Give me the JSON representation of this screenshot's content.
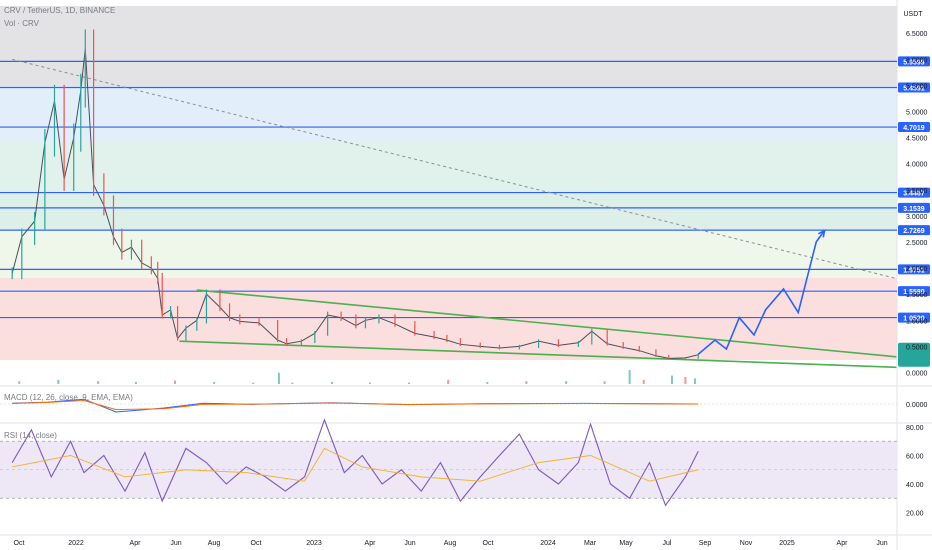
{
  "header": {
    "symbol_line": "CRV / TetherUS, 1D, BINANCE",
    "volume_line": "Vol · CRV",
    "currency": "USDT"
  },
  "colors": {
    "up": "#26a69a",
    "down": "#ef5350",
    "level_line": "#2962ff",
    "trend_line": "#4caf50",
    "projection": "#2962ff",
    "rsi_band": "#e9e3f7",
    "rsi_line": "#7e57c2",
    "rsi_ma": "#f0b429",
    "macd_line": "#2962ff",
    "macd_signal": "#ff6d00",
    "last_price_tag": "#26a69a"
  },
  "chart_data": [
    {
      "type": "line",
      "title": "CRV / TetherUS, 1D, BINANCE",
      "price_axis_ticks": [
        "6.5000",
        "6.0000",
        "5.5000",
        "5.0000",
        "4.5000",
        "4.0000",
        "3.5000",
        "3.0000",
        "2.5000",
        "2.0000",
        "1.5000",
        "1.0000",
        "0.5000",
        "0.0000"
      ],
      "time_axis_ticks": [
        "Oct",
        "2022",
        "Apr",
        "Jun",
        "Aug",
        "Oct",
        "2023",
        "Apr",
        "Jun",
        "Aug",
        "Oct",
        "2024",
        "Mar",
        "May",
        "Jul",
        "Sep",
        "Nov",
        "2025",
        "Apr",
        "Jun"
      ],
      "horizontal_levels": [
        "5.9599",
        "5.4591",
        "4.7019",
        "3.4467",
        "3.1539",
        "2.7269",
        "1.9751",
        "1.5580",
        "1.0520"
      ],
      "price_series": {
        "name": "",
        "dates": [
          "2021-09-20",
          "2021-10-05",
          "2021-10-25",
          "2021-11-10",
          "2021-11-25",
          "2021-12-10",
          "2021-12-25",
          "2022-01-05",
          "2022-01-12",
          "2022-01-25",
          "2022-02-10",
          "2022-02-25",
          "2022-03-10",
          "2022-03-25",
          "2022-04-10",
          "2022-04-25",
          "2022-05-05",
          "2022-05-12",
          "2022-05-25",
          "2022-06-05",
          "2022-06-18",
          "2022-07-05",
          "2022-07-20",
          "2022-08-10",
          "2022-08-25",
          "2022-09-10",
          "2022-10-10",
          "2022-11-08",
          "2022-11-22",
          "2022-12-15",
          "2023-01-05",
          "2023-01-25",
          "2023-02-15",
          "2023-03-10",
          "2023-03-25",
          "2023-04-15",
          "2023-05-10",
          "2023-06-10",
          "2023-07-10",
          "2023-07-30",
          "2023-08-20",
          "2023-09-20",
          "2023-10-20",
          "2023-11-20",
          "2023-12-20",
          "2024-01-20",
          "2024-02-20",
          "2024-03-12",
          "2024-04-05",
          "2024-04-30",
          "2024-05-25",
          "2024-06-20",
          "2024-07-10",
          "2024-08-05",
          "2024-08-25"
        ],
        "values": [
          1.9,
          2.6,
          2.9,
          4.4,
          5.2,
          3.7,
          4.5,
          5.4,
          6.2,
          3.6,
          3.2,
          2.6,
          2.3,
          2.4,
          2.1,
          2.0,
          1.8,
          1.1,
          1.2,
          0.65,
          0.85,
          1.0,
          1.5,
          1.25,
          1.05,
          0.98,
          0.95,
          0.62,
          0.55,
          0.6,
          0.75,
          1.1,
          1.05,
          0.9,
          1.0,
          1.05,
          0.93,
          0.75,
          0.68,
          0.62,
          0.54,
          0.5,
          0.47,
          0.5,
          0.6,
          0.52,
          0.57,
          0.79,
          0.55,
          0.48,
          0.42,
          0.32,
          0.27,
          0.28,
          0.34
        ]
      },
      "projection_path": {
        "name": "",
        "dates": [
          "2024-08-25",
          "2024-09-20",
          "2024-10-08",
          "2024-10-28",
          "2024-11-20",
          "2024-12-08",
          "2025-01-05",
          "2025-01-28",
          "2025-02-25",
          "2025-03-10"
        ],
        "values": [
          0.35,
          0.62,
          0.45,
          1.05,
          0.72,
          1.2,
          1.6,
          1.15,
          2.5,
          2.72
        ]
      },
      "trend_lines": [
        {
          "dates": [
            "2022-07-05",
            "2025-06-30"
          ],
          "values": [
            1.58,
            0.3
          ]
        },
        {
          "dates": [
            "2022-06-08",
            "2025-06-30"
          ],
          "values": [
            0.6,
            0.1
          ]
        },
        {
          "dates": [
            "2021-09-20",
            "2025-06-30"
          ],
          "values": [
            6.0,
            1.8
          ]
        }
      ]
    },
    {
      "type": "bar",
      "title": "Vol · CRV",
      "dates": [
        "2021-10-01",
        "2021-12-01",
        "2022-02-01",
        "2022-04-01",
        "2022-06-01",
        "2022-08-01",
        "2022-10-01",
        "2022-11-10",
        "2022-12-01",
        "2023-02-01",
        "2023-04-01",
        "2023-06-01",
        "2023-08-01",
        "2023-10-01",
        "2023-12-01",
        "2024-02-01",
        "2024-04-01",
        "2024-05-10",
        "2024-06-01",
        "2024-07-15",
        "2024-08-05",
        "2024-08-20"
      ],
      "values": [
        2,
        3,
        2,
        1.5,
        2.5,
        1.5,
        1,
        8,
        1,
        1.5,
        1,
        1,
        3,
        1.5,
        2,
        2,
        2,
        10,
        3,
        6,
        5,
        4
      ]
    },
    {
      "type": "line",
      "title": "MACD (12, 26, close, 9, EMA, EMA)",
      "axis_ticks": [
        "0.0000"
      ],
      "series": [
        {
          "name": "",
          "dates": [
            "2021-09-20",
            "2021-11-15",
            "2022-01-10",
            "2022-03-01",
            "2022-05-15",
            "2022-07-15",
            "2022-10-01",
            "2023-02-01",
            "2023-06-01",
            "2023-10-01",
            "2024-03-01",
            "2024-08-25"
          ],
          "values": [
            0.05,
            0.12,
            0.3,
            -0.5,
            -0.25,
            0.05,
            -0.02,
            0.08,
            -0.04,
            0.02,
            0.04,
            0.0
          ]
        },
        {
          "name": "",
          "dates": [
            "2021-09-20",
            "2021-11-15",
            "2022-01-10",
            "2022-03-01",
            "2022-05-15",
            "2022-07-15",
            "2022-10-01",
            "2023-02-01",
            "2023-06-01",
            "2023-10-01",
            "2024-03-01",
            "2024-08-25"
          ],
          "values": [
            0.03,
            0.1,
            0.22,
            -0.35,
            -0.3,
            -0.02,
            -0.01,
            0.06,
            -0.03,
            0.01,
            0.03,
            0.0
          ]
        }
      ]
    },
    {
      "type": "line",
      "title": "RSI (14, close)",
      "axis_ticks": [
        "80.00",
        "60.00",
        "40.00",
        "20.00"
      ],
      "band": [
        30,
        70
      ],
      "series": [
        {
          "name": "",
          "dates": [
            "2021-09-20",
            "2021-10-20",
            "2021-11-20",
            "2021-12-20",
            "2022-01-10",
            "2022-02-10",
            "2022-03-15",
            "2022-04-15",
            "2022-05-12",
            "2022-06-18",
            "2022-07-20",
            "2022-08-20",
            "2022-09-20",
            "2022-10-20",
            "2022-11-20",
            "2022-12-20",
            "2023-01-20",
            "2023-02-20",
            "2023-03-20",
            "2023-04-20",
            "2023-05-20",
            "2023-06-20",
            "2023-07-20",
            "2023-08-20",
            "2023-09-20",
            "2023-10-20",
            "2023-11-20",
            "2023-12-20",
            "2024-01-20",
            "2024-02-20",
            "2024-03-10",
            "2024-04-10",
            "2024-05-10",
            "2024-06-10",
            "2024-07-05",
            "2024-08-05",
            "2024-08-25"
          ],
          "values": [
            55,
            78,
            45,
            70,
            48,
            60,
            35,
            62,
            28,
            65,
            55,
            40,
            52,
            45,
            35,
            45,
            85,
            48,
            60,
            40,
            50,
            35,
            55,
            28,
            45,
            60,
            75,
            50,
            40,
            55,
            82,
            40,
            30,
            55,
            25,
            45,
            63
          ]
        },
        {
          "name": "",
          "dates": [
            "2021-09-20",
            "2021-12-20",
            "2022-03-15",
            "2022-06-18",
            "2022-09-20",
            "2022-12-20",
            "2023-01-20",
            "2023-03-20",
            "2023-06-20",
            "2023-09-20",
            "2023-12-20",
            "2024-03-10",
            "2024-06-10",
            "2024-08-25"
          ],
          "values": [
            52,
            60,
            45,
            50,
            48,
            42,
            65,
            52,
            45,
            42,
            55,
            60,
            42,
            50
          ]
        }
      ]
    }
  ]
}
